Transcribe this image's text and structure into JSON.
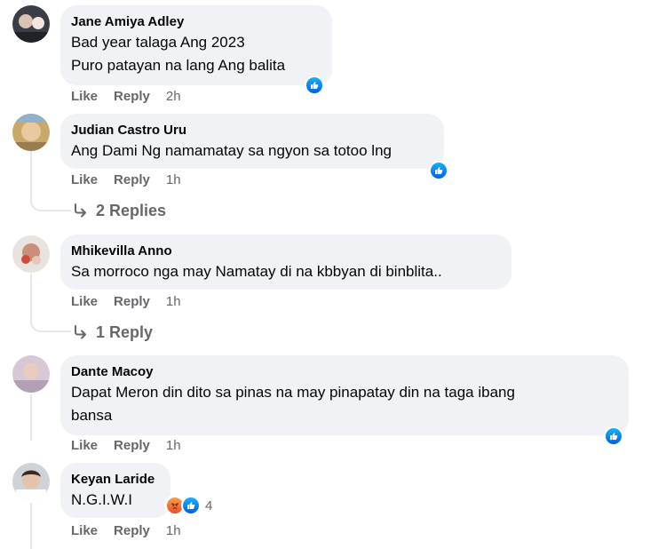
{
  "comments": [
    {
      "author": "Jane Amiya Adley",
      "text_lines": [
        "Bad year talaga Ang 2023",
        "Puro patayan na lang Ang balita"
      ],
      "actions": {
        "like": "Like",
        "reply": "Reply",
        "time": "2h"
      },
      "reaction": "like-icon"
    },
    {
      "author": "Judian Castro Uru",
      "text_lines": [
        "Ang Dami Ng namamatay sa ngyon sa totoo lng"
      ],
      "actions": {
        "like": "Like",
        "reply": "Reply",
        "time": "1h"
      },
      "reaction": "like-icon",
      "replies_label": "2 Replies"
    },
    {
      "author": "Mhikevilla Anno",
      "text_lines": [
        "Sa morroco nga may Namatay di na kbbyan di binblita.."
      ],
      "actions": {
        "like": "Like",
        "reply": "Reply",
        "time": "1h"
      },
      "replies_label": "1 Reply"
    },
    {
      "author": "Dante Macoy",
      "text_lines": [
        "Dapat Meron din dito sa pinas na may pinapatay din na taga ibang",
        "bansa"
      ],
      "actions": {
        "like": "Like",
        "reply": "Reply",
        "time": "1h"
      },
      "reaction": "like-icon"
    },
    {
      "author": "Keyan Laride",
      "text_lines": [
        "N.G.I.W.I"
      ],
      "actions": {
        "like": "Like",
        "reply": "Reply",
        "time": "1h"
      },
      "reactions": [
        "angry-icon",
        "like-icon"
      ],
      "reaction_count": "4"
    }
  ],
  "colors": {
    "bubble": "#f0f2f5",
    "meta": "#65676b",
    "like_blue": "#1877f2",
    "angry": "#f0552a"
  }
}
